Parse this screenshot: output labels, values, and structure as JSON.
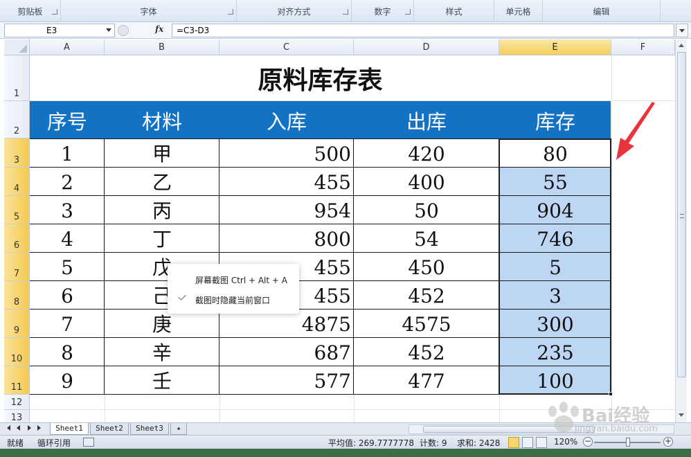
{
  "ribbon": {
    "groups": [
      "剪贴板",
      "字体",
      "对齐方式",
      "数字",
      "样式",
      "单元格",
      "编辑"
    ]
  },
  "formula_bar": {
    "name_box": "E3",
    "fx_label": "fx",
    "formula": "=C3-D3"
  },
  "columns": [
    "A",
    "B",
    "C",
    "D",
    "E",
    "F"
  ],
  "rows": [
    "1",
    "2",
    "3",
    "4",
    "5",
    "6",
    "7",
    "8",
    "9",
    "10",
    "11",
    "12",
    "13"
  ],
  "sheet": {
    "title": "原料库存表",
    "headers": [
      "序号",
      "材料",
      "入库",
      "出库",
      "库存"
    ],
    "data": [
      [
        "1",
        "甲",
        "500",
        "420",
        "80"
      ],
      [
        "2",
        "乙",
        "455",
        "400",
        "55"
      ],
      [
        "3",
        "丙",
        "954",
        "50",
        "904"
      ],
      [
        "4",
        "丁",
        "800",
        "54",
        "746"
      ],
      [
        "5",
        "戊",
        "455",
        "450",
        "5"
      ],
      [
        "6",
        "己",
        "455",
        "452",
        "3"
      ],
      [
        "7",
        "庚",
        "4875",
        "4575",
        "300"
      ],
      [
        "8",
        "辛",
        "687",
        "452",
        "235"
      ],
      [
        "9",
        "壬",
        "577",
        "477",
        "100"
      ]
    ]
  },
  "popup": {
    "item1": "屏幕截图 Ctrl + Alt + A",
    "item2": "截图时隐藏当前窗口"
  },
  "tabs": [
    "Sheet1",
    "Sheet2",
    "Sheet3"
  ],
  "status": {
    "mode": "就绪",
    "circular": "循环引用",
    "average": "平均值: 269.7777778",
    "count": "计数: 9",
    "sum": "求和: 2428",
    "zoom": "120%",
    "zoom_minus": "−",
    "zoom_plus": "+"
  },
  "watermark": {
    "brand": "Bai经验",
    "url": "jingyan.baidu.com"
  },
  "colors": {
    "header_band": "#1472c4",
    "selection_fill": "#bcd6f4",
    "arrow": "#e8343a"
  }
}
